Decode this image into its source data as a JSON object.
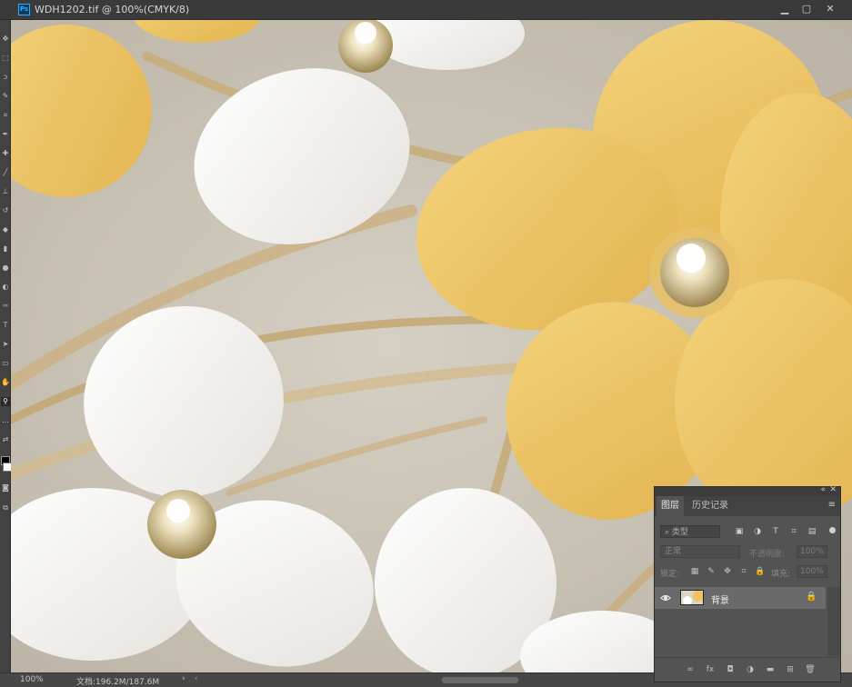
{
  "window": {
    "app_icon_label": "Ps",
    "document_title": "WDH1202.tif @ 100%(CMYK/8)",
    "minimize_symbol": "▁",
    "restore_symbol": "▢",
    "close_symbol": "✕"
  },
  "toolbar": {
    "tools": [
      {
        "name": "move-tool-icon",
        "glyph": "✥"
      },
      {
        "name": "marquee-tool-icon",
        "glyph": "⬚"
      },
      {
        "name": "lasso-tool-icon",
        "glyph": "ↄ"
      },
      {
        "name": "quick-select-tool-icon",
        "glyph": "✎"
      },
      {
        "name": "crop-tool-icon",
        "glyph": "⌗"
      },
      {
        "name": "eyedropper-tool-icon",
        "glyph": "✒"
      },
      {
        "name": "healing-tool-icon",
        "glyph": "✚"
      },
      {
        "name": "brush-tool-icon",
        "glyph": "╱"
      },
      {
        "name": "stamp-tool-icon",
        "glyph": "⊥"
      },
      {
        "name": "history-brush-tool-icon",
        "glyph": "↺"
      },
      {
        "name": "eraser-tool-icon",
        "glyph": "◆"
      },
      {
        "name": "gradient-tool-icon",
        "glyph": "▮"
      },
      {
        "name": "blur-tool-icon",
        "glyph": "●"
      },
      {
        "name": "dodge-tool-icon",
        "glyph": "◐"
      },
      {
        "name": "pen-tool-icon",
        "glyph": "✑"
      },
      {
        "name": "type-tool-icon",
        "glyph": "T"
      },
      {
        "name": "path-select-tool-icon",
        "glyph": "➤"
      },
      {
        "name": "shape-tool-icon",
        "glyph": "▭"
      },
      {
        "name": "hand-tool-icon",
        "glyph": "✋"
      },
      {
        "name": "zoom-tool-icon",
        "glyph": "⚲"
      },
      {
        "name": "more-tools-icon",
        "glyph": "…"
      },
      {
        "name": "swap-colors-icon",
        "glyph": "⇄"
      }
    ],
    "extra_tools": [
      {
        "name": "quick-mask-icon",
        "glyph": "◙"
      },
      {
        "name": "screen-mode-icon",
        "glyph": "⧉"
      }
    ]
  },
  "statusbar": {
    "zoom": "100%",
    "doc_info": "文档:196.2M/187.6M",
    "arrow": "›",
    "scroll_left": "‹"
  },
  "layers_panel": {
    "collapse_symbol": "«",
    "close_symbol": "✕",
    "menu_symbol": "≡",
    "tabs": [
      {
        "label": "图层",
        "active": true
      },
      {
        "label": "历史记录",
        "active": false
      }
    ],
    "filter": {
      "placeholder": "⌕ 类型",
      "icons": [
        "▣",
        "◑",
        "T",
        "⌗",
        "▤"
      ]
    },
    "blend_mode": "正常",
    "opacity_label": "不透明度:",
    "opacity_value": "100%",
    "lock_label": "锁定:",
    "lock_icons": [
      "▦",
      "✎",
      "✥",
      "⌗",
      "🔒"
    ],
    "fill_label": "填充:",
    "fill_value": "100%",
    "layers": [
      {
        "name": "背景",
        "visible": true,
        "locked": true
      }
    ],
    "footer_icons": [
      {
        "name": "link-layers-icon",
        "glyph": "∞"
      },
      {
        "name": "layer-style-icon",
        "glyph": "fx"
      },
      {
        "name": "add-mask-icon",
        "glyph": "◘"
      },
      {
        "name": "adjustment-layer-icon",
        "glyph": "◑"
      },
      {
        "name": "new-group-icon",
        "glyph": "▬"
      },
      {
        "name": "new-layer-icon",
        "glyph": "⊞"
      },
      {
        "name": "delete-layer-icon",
        "glyph": "🗑"
      }
    ]
  },
  "colors": {
    "yellow_petal": "#eec45e",
    "white_petal": "#f7f5f2",
    "background": "#c9c3b7",
    "gold_stem": "#c8ad7a"
  }
}
